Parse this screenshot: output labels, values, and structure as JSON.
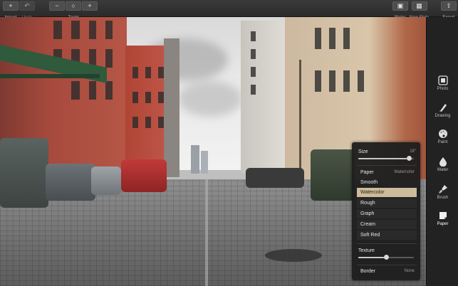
{
  "toolbar": {
    "import_label": "Import",
    "undo_label": "Undo",
    "zoom_label": "Zoom",
    "styles_label": "Styles",
    "new_style_label": "New Style",
    "export_label": "Export",
    "undo_enabled": false
  },
  "sidepanel": {
    "tools": [
      {
        "label": "Photo",
        "icon": "photo-icon"
      },
      {
        "label": "Drawing",
        "icon": "pencil-icon"
      },
      {
        "label": "Paint",
        "icon": "palette-icon"
      },
      {
        "label": "Water",
        "icon": "drop-icon"
      },
      {
        "label": "Brush",
        "icon": "brush-icon"
      },
      {
        "label": "Paper",
        "icon": "paper-icon"
      }
    ],
    "active_tool": "Paper"
  },
  "paper_panel": {
    "size_label": "Size",
    "size_value": "18\"",
    "size_level": 0.92,
    "paper_label": "Paper",
    "paper_value": "Watercolor",
    "options": [
      "Watercolor",
      "Rough",
      "Graph",
      "Cream",
      "Soft Red"
    ],
    "first_option": "Smooth",
    "selected_option": "Watercolor",
    "texture_label": "Texture",
    "texture_level": 0.5,
    "border_label": "Border",
    "border_value": "None"
  },
  "colors": {
    "accent_selected": "#cdbb99",
    "brick": "#a0453a",
    "panel_bg": "#222222"
  }
}
